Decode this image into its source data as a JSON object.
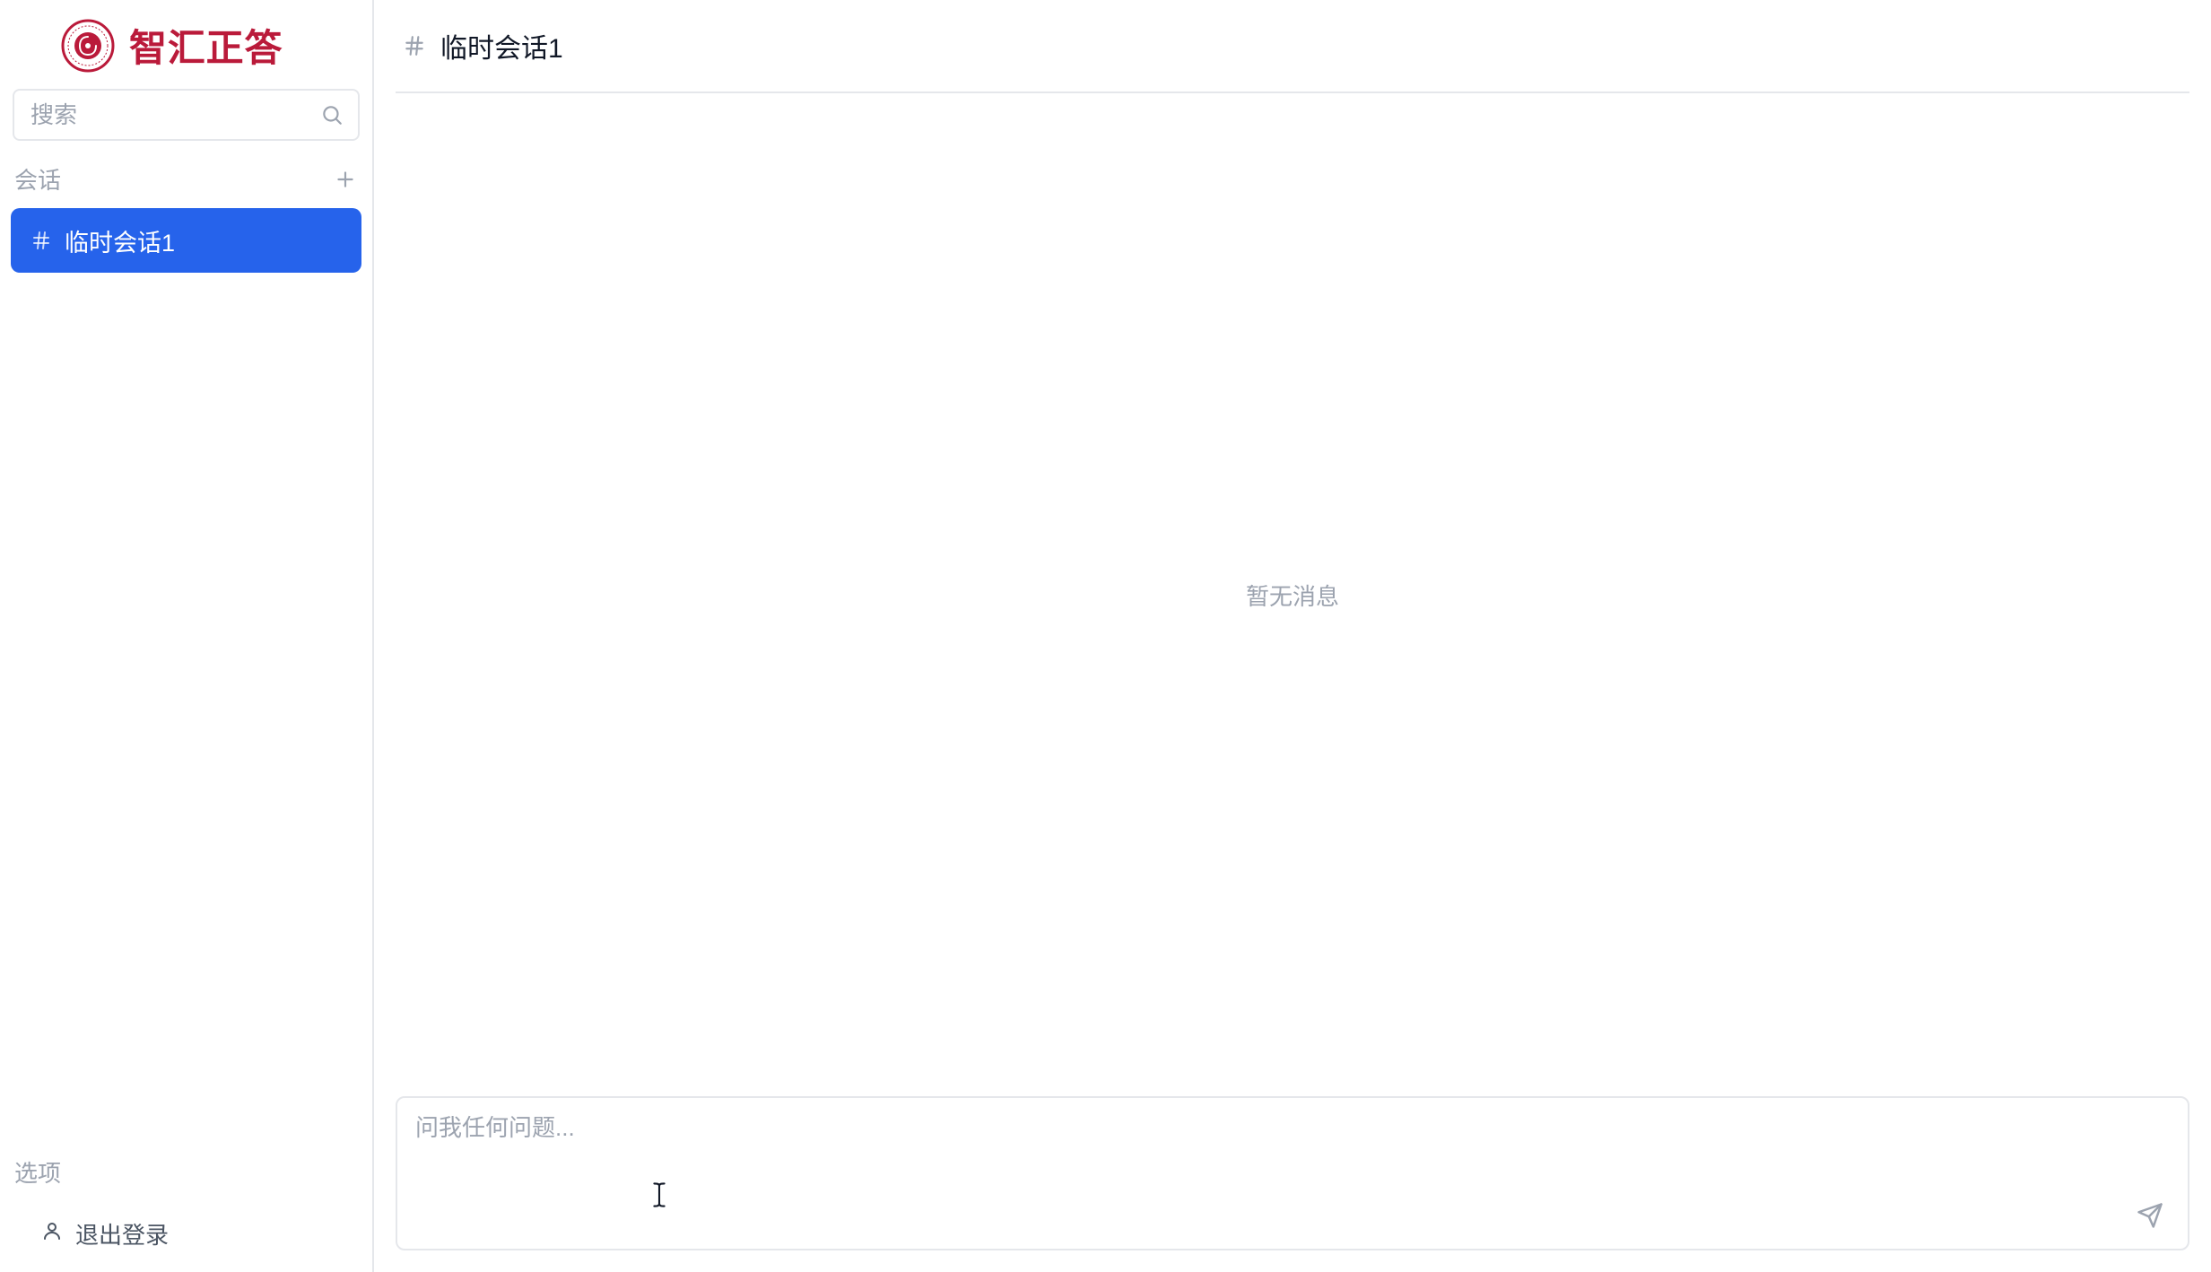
{
  "brand": {
    "title": "智汇正答",
    "accent_color": "#ba1a3a",
    "primary_color": "#2663eb"
  },
  "search": {
    "placeholder": "搜索"
  },
  "sessions": {
    "header": "会话",
    "items": [
      {
        "name": "临时会话1",
        "active": true
      }
    ]
  },
  "options": {
    "header": "选项",
    "logout_label": "退出登录"
  },
  "main": {
    "title": "临时会话1",
    "empty_text": "暂无消息"
  },
  "composer": {
    "placeholder": "问我任何问题..."
  }
}
